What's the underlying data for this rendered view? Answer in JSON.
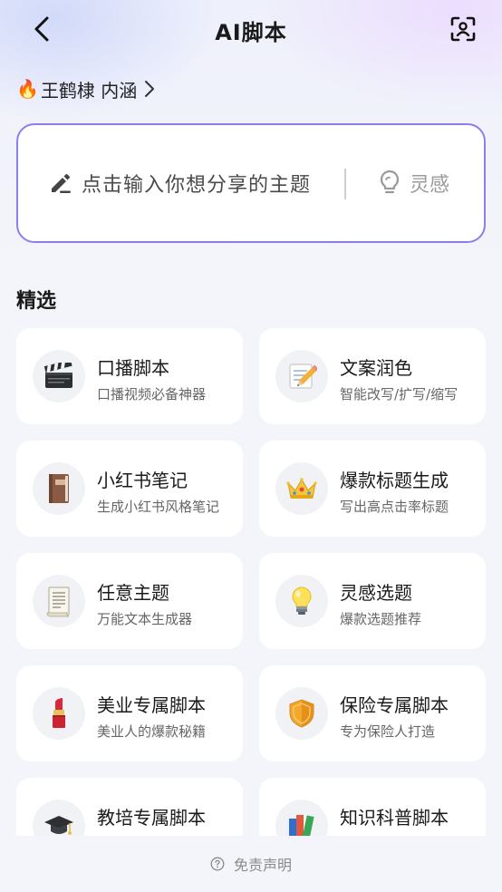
{
  "header": {
    "title": "AI脚本"
  },
  "topic": {
    "label": "王鹤棣 内涵",
    "icon": "fire-icon"
  },
  "input": {
    "placeholder": "点击输入你想分享的主题",
    "inspiration_label": "灵感"
  },
  "accent_color": "#8b7ff0",
  "section": {
    "title": "精选"
  },
  "cards": [
    {
      "title": "口播脚本",
      "subtitle": "口播视频必备神器",
      "icon": "clapperboard-icon"
    },
    {
      "title": "文案润色",
      "subtitle": "智能改写/扩写/缩写",
      "icon": "memo-pencil-icon"
    },
    {
      "title": "小红书笔记",
      "subtitle": "生成小红书风格笔记",
      "icon": "notebook-icon"
    },
    {
      "title": "爆款标题生成",
      "subtitle": "写出高点击率标题",
      "icon": "crown-icon"
    },
    {
      "title": "任意主题",
      "subtitle": "万能文本生成器",
      "icon": "scroll-icon"
    },
    {
      "title": "灵感选题",
      "subtitle": "爆款选题推荐",
      "icon": "light-bulb-icon"
    },
    {
      "title": "美业专属脚本",
      "subtitle": "美业人的爆款秘籍",
      "icon": "lipstick-icon"
    },
    {
      "title": "保险专属脚本",
      "subtitle": "专为保险人打造",
      "icon": "shield-icon"
    },
    {
      "title": "教培专属脚本",
      "subtitle": "",
      "icon": "graduation-cap-icon"
    },
    {
      "title": "知识科普脚本",
      "subtitle": "",
      "icon": "books-icon"
    }
  ],
  "footer": {
    "label": "免责声明"
  }
}
